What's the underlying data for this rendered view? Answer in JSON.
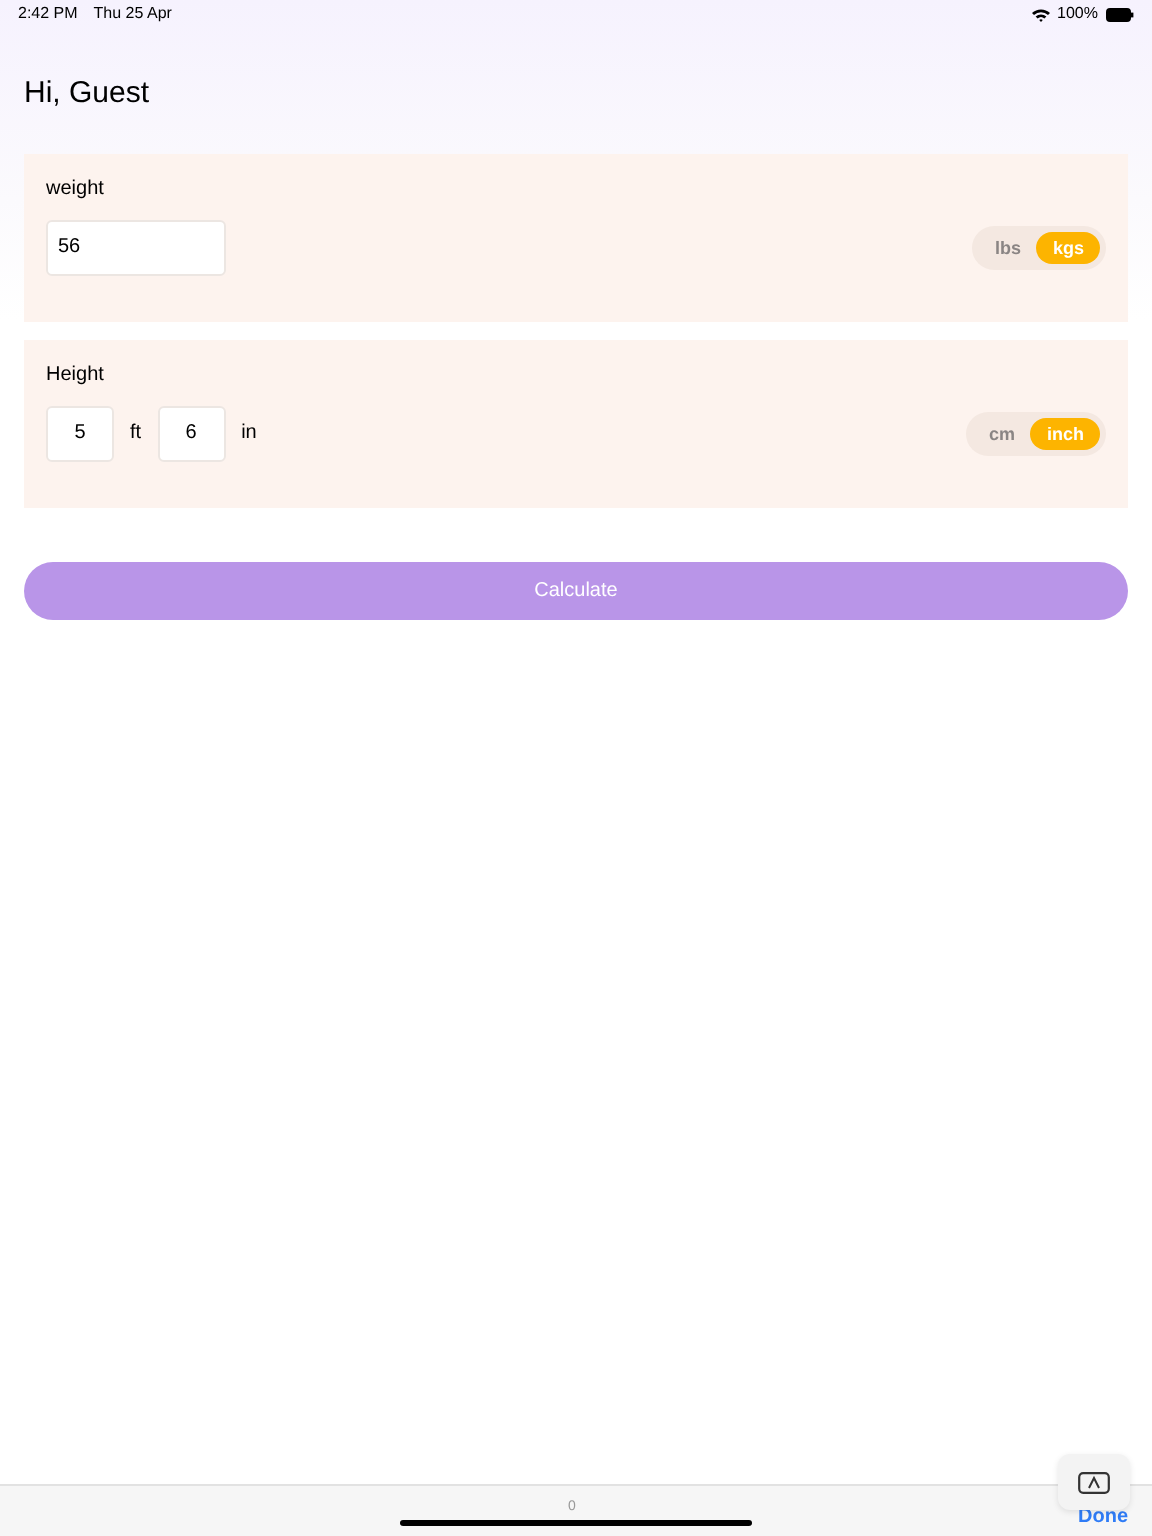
{
  "status_bar": {
    "time": "2:42 PM",
    "date": "Thu 25 Apr",
    "battery": "100%"
  },
  "greeting": "Hi, Guest",
  "sections": [
    {
      "title": "weight",
      "fields": [
        {
          "value": "56"
        }
      ],
      "units": [
        {
          "label": "lbs",
          "selected": false
        },
        {
          "label": "kgs",
          "selected": true
        }
      ]
    },
    {
      "title": "Height",
      "fields": [
        {
          "value": "5",
          "unit": "ft"
        },
        {
          "value": "6",
          "unit": "in"
        }
      ],
      "units": [
        {
          "label": "cm",
          "selected": false
        },
        {
          "label": "inch",
          "selected": true
        }
      ]
    }
  ],
  "calculate_button": "Calculate",
  "keyboard_bar": {
    "suggestion": "0",
    "done": "Done"
  }
}
